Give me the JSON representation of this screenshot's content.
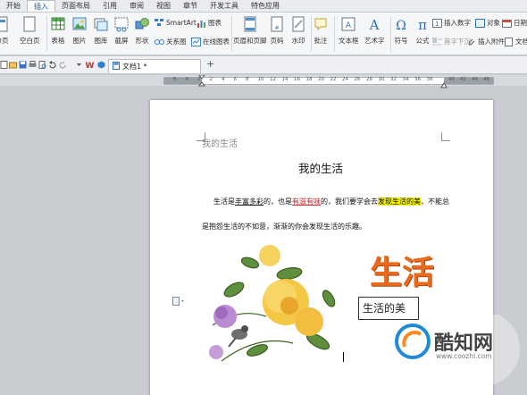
{
  "menu": {
    "tabs": [
      "开始",
      "插入",
      "页面布局",
      "引用",
      "审阅",
      "视图",
      "章节",
      "开发工具",
      "特色应用"
    ],
    "active_index": 1
  },
  "ribbon": {
    "cover_page": "分页",
    "blank_page": "空白页",
    "table": "表格",
    "picture": "图片",
    "gallery": "图库",
    "screenshot": "截屏",
    "shapes": "形状",
    "smartart": "SmartArt",
    "chart": "图表",
    "relationship": "关系图",
    "online_chart": "在线图表",
    "header_footer": "页眉和页脚",
    "page_number": "页码",
    "watermark": "水印",
    "comment": "批注",
    "text_box": "文本框",
    "word_art": "艺术字",
    "symbol": "符号",
    "formula": "公式",
    "insert_number": "插入数字",
    "object": "对象",
    "date": "日期",
    "first_drop_cap": "首字下沉",
    "insert_attachment": "插入附件",
    "doc_parts": "文档部"
  },
  "quickbar": {
    "doc_tab_label": "文档1 *",
    "new_tab": "+"
  },
  "ruler": {
    "left_numbers": [
      "6",
      "4",
      "2",
      "2",
      "4",
      "6",
      "8",
      "10",
      "12",
      "14",
      "16",
      "18",
      "20",
      "22",
      "24",
      "26",
      "28",
      "30",
      "32",
      "34",
      "36",
      "38"
    ],
    "right_numbers": [
      "40",
      "42",
      "44",
      "46"
    ]
  },
  "document": {
    "header_text": "我的生活",
    "title": "我的生活",
    "line1": {
      "p1": "生活是",
      "p2": "丰富多彩",
      "p3": "的，也是",
      "p4": "有滋有味",
      "p5": "的，我们要学会去",
      "p6": "发现生活的美",
      "p7": "，不能总"
    },
    "line2": "是抱怨生活的不如意，渐渐的你会发现生活的乐趣。",
    "wordart": "生活",
    "textbox": "生活的美"
  },
  "watermark": {
    "logo_text": "酷知网",
    "url": "www.coozhi.com"
  },
  "colors": {
    "accent": "#1a5fb4",
    "wordart_orange": "#e86a1c",
    "highlight": "#f5f500",
    "link_red": "#d32020"
  }
}
